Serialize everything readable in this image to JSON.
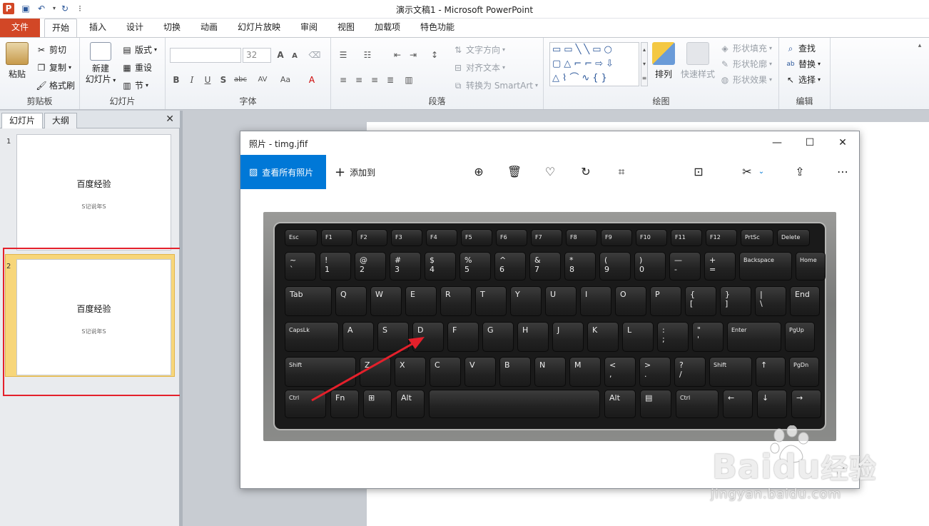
{
  "window": {
    "title": "演示文稿1  -  Microsoft PowerPoint"
  },
  "ribbon": {
    "tabs": [
      {
        "label": "文件",
        "active": false,
        "file": true
      },
      {
        "label": "开始",
        "active": true
      },
      {
        "label": "插入"
      },
      {
        "label": "设计"
      },
      {
        "label": "切换"
      },
      {
        "label": "动画"
      },
      {
        "label": "幻灯片放映"
      },
      {
        "label": "审阅"
      },
      {
        "label": "视图"
      },
      {
        "label": "加载项"
      },
      {
        "label": "特色功能"
      }
    ],
    "clipboard": {
      "paste": "粘贴",
      "cut": "剪切",
      "copy": "复制",
      "format_painter": "格式刷",
      "group": "剪贴板"
    },
    "slides": {
      "new_slide_1": "新建",
      "new_slide_2": "幻灯片",
      "layout": "版式",
      "reset": "重设",
      "section": "节",
      "group": "幻灯片"
    },
    "font": {
      "font_name": "",
      "font_size": "32",
      "group": "字体"
    },
    "paragraph": {
      "text_direction": "文字方向",
      "align_text": "对齐文本",
      "smartart": "转换为 SmartArt",
      "group": "段落"
    },
    "drawing": {
      "arrange": "排列",
      "quick_styles": "快速样式",
      "shape_fill": "形状填充",
      "shape_outline": "形状轮廓",
      "shape_effects": "形状效果",
      "group": "绘图"
    },
    "editing": {
      "find": "查找",
      "replace": "替换",
      "select": "选择",
      "group": "编辑"
    }
  },
  "left_panel": {
    "tab_slides": "幻灯片",
    "tab_outline": "大纲",
    "slides": [
      {
        "number": "1",
        "title": "百度经验",
        "subtitle": "S记说年S"
      },
      {
        "number": "2",
        "title": "百度经验",
        "subtitle": "S记说年S"
      }
    ]
  },
  "photos_app": {
    "title": "照片 - timg.jfif",
    "view_all": "查看所有照片",
    "add_to": "添加到",
    "image_description": "laptop keyboard photo",
    "keyboard": {
      "row_fn": [
        "Esc",
        "F1",
        "F2",
        "F3",
        "F4",
        "F5",
        "F6",
        "F7",
        "F8",
        "F9",
        "F10",
        "F11",
        "F12",
        "PrtSc",
        "Delete"
      ],
      "row_num": [
        "~ `",
        "! 1",
        "@ 2",
        "# 3",
        "$ 4",
        "% 5",
        "^ 6",
        "& 7",
        "* 8",
        "( 9",
        ") 0",
        "— -",
        "+ =",
        "Backspace",
        "Home"
      ],
      "row_q": [
        "Tab",
        "Q",
        "W",
        "E",
        "R",
        "T",
        "Y",
        "U",
        "I",
        "O",
        "P",
        "{ [",
        "} ]",
        "| \\",
        "End"
      ],
      "row_a": [
        "CapsLk",
        "A",
        "S",
        "D",
        "F",
        "G",
        "H",
        "J",
        "K",
        "L",
        ": ;",
        "\" '",
        "Enter",
        "PgUp"
      ],
      "row_z": [
        "Shift",
        "Z",
        "X",
        "C",
        "V",
        "B",
        "N",
        "M",
        "< ,",
        "> .",
        "? /",
        "Shift",
        "↑",
        "PgDn"
      ],
      "row_ctrl": [
        "Ctrl",
        "Fn",
        "⊞",
        "Alt",
        "",
        "Alt",
        "▤",
        "Ctrl",
        "←",
        "↓",
        "→"
      ]
    },
    "arrow_color": "#e4202b"
  },
  "watermark": {
    "line1": "Bai",
    "line1b": "du",
    "line1c": "经验",
    "line2": "jingyan.baidu.com"
  },
  "colors": {
    "file_tab": "#d24726",
    "accent": "#0078d7",
    "selection": "#f7d67a",
    "highlight_box": "#e4202b"
  }
}
